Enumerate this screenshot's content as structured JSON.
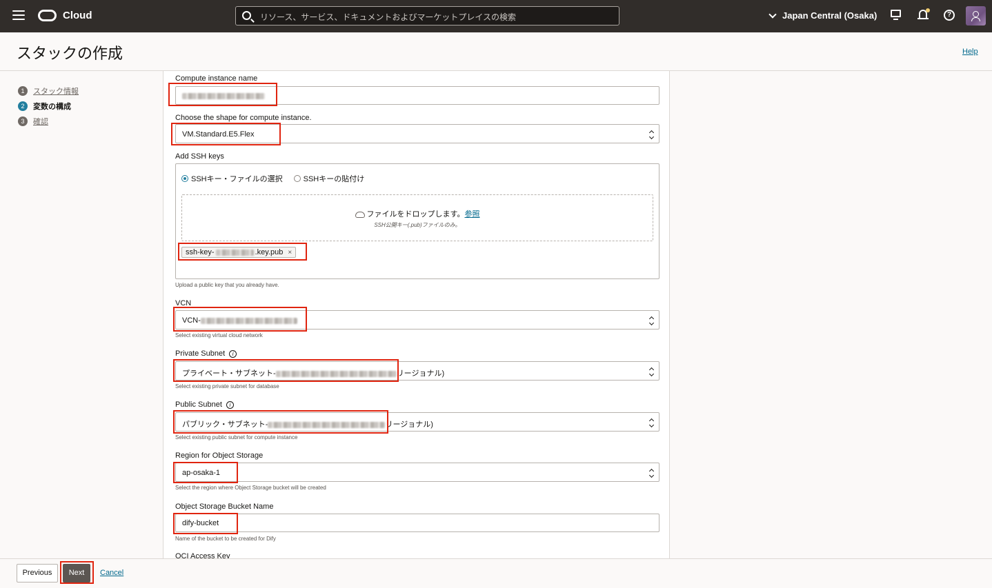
{
  "topbar": {
    "brand": "Cloud",
    "search_placeholder": "リソース、サービス、ドキュメントおよびマーケットプレイスの検索",
    "region": "Japan Central (Osaka)"
  },
  "page": {
    "title": "スタックの作成",
    "help": "Help"
  },
  "steps": [
    {
      "num": "1",
      "label": "スタック情報"
    },
    {
      "num": "2",
      "label": "変数の構成"
    },
    {
      "num": "3",
      "label": "確認"
    }
  ],
  "form": {
    "compute_name": {
      "label": "Compute instance name"
    },
    "shape": {
      "label": "Choose the shape for compute instance.",
      "value": "VM.Standard.E5.Flex"
    },
    "ssh": {
      "label": "Add SSH keys",
      "option_file": "SSHキー・ファイルの選択",
      "option_paste": "SSHキーの貼付け",
      "drop_text": "ファイルをドロップします。",
      "drop_link": "参照",
      "drop_sub": "SSH公開キー(.pub)ファイルのみ。",
      "chip_prefix": "ssh-key-",
      "chip_suffix": ".key.pub",
      "chip_remove": "×",
      "help": "Upload a public key that you already have."
    },
    "vcn": {
      "label": "VCN",
      "value_prefix": "VCN-",
      "help": "Select existing virtual cloud network"
    },
    "private_subnet": {
      "label": "Private Subnet",
      "info": "i",
      "value_prefix": "プライベート・サブネット-",
      "value_suffix": "リージョナル)",
      "help": "Select existing private subnet for database"
    },
    "public_subnet": {
      "label": "Public Subnet",
      "info": "i",
      "value_prefix": "パブリック・サブネット-",
      "value_suffix": "リージョナル)",
      "help": "Select existing public subnet for compute instance"
    },
    "os_region": {
      "label": "Region for Object Storage",
      "value": "ap-osaka-1",
      "help": "Select the region where Object Storage bucket will be created"
    },
    "bucket": {
      "label": "Object Storage Bucket Name",
      "value": "dify-bucket",
      "help": "Name of the bucket to be created for Dify"
    },
    "next_section": {
      "label": "OCI Access Key"
    }
  },
  "footer": {
    "previous": "Previous",
    "next": "Next",
    "cancel": "Cancel"
  },
  "colors": {
    "topbar": "#312d2a",
    "highlight": "#e0240f",
    "link": "#00688c"
  }
}
